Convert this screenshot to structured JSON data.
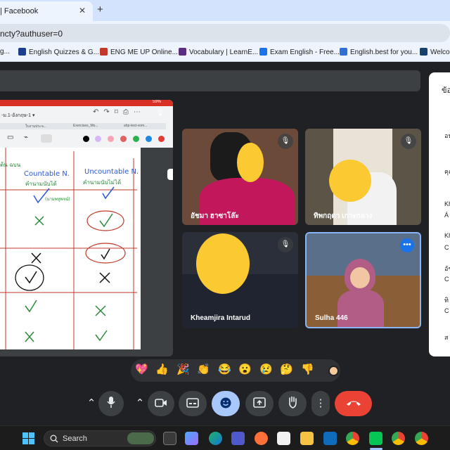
{
  "browser": {
    "tab_title": "| Facebook",
    "tab_close": "✕",
    "new_tab": "+",
    "url": "ncty?authuser=0",
    "bookmarks": [
      {
        "label": "g...",
        "color": "#2f6fd6"
      },
      {
        "label": "English Quizzes & G...",
        "color": "#1a3f8f"
      },
      {
        "label": "ENG ME UP Online...",
        "color": "#c0392b"
      },
      {
        "label": "Vocabulary | LearnE...",
        "color": "#5b2c83"
      },
      {
        "label": "Exam English - Free...",
        "color": "#1a73e8"
      },
      {
        "label": "English.best for you...",
        "color": "#2f6fd6"
      },
      {
        "label": "Welcom",
        "color": "#16406e"
      }
    ]
  },
  "presentation": {
    "tablet_title": "-ม.1-อังกฤษ-1 ▾",
    "tablet_tabs": [
      "ใบงานประจ...",
      "Exercises_Mo...",
      "ahp-test-vom..."
    ],
    "battery": "59%",
    "countable_label": "Countable N.",
    "countable_sub": "คำนามนับได้",
    "uncountable_label": "Uncountable N.",
    "uncountable_sub": "คำนามนับไม่ได้",
    "note": "(นามพหูพจน์)",
    "row_label": "ต้น ฉบน"
  },
  "participants": [
    {
      "name": "อัชมา ฮาซาโล๊ะ",
      "mic": "muted"
    },
    {
      "name": "ทิพกฤตา เกาะกลาง",
      "mic": "muted"
    },
    {
      "name": "Kheamjira Intarud",
      "mic": "muted"
    },
    {
      "name": "Sulha 446",
      "mic": "active"
    }
  ],
  "side_panel": {
    "heading": "ข้อ",
    "items": [
      "อนุ",
      "คุณ",
      "Kh",
      "Á",
      "Kh",
      "C",
      "อัช",
      "C",
      "ทิ",
      "C",
      "ส"
    ]
  },
  "reactions": [
    "💖",
    "👍",
    "🎉",
    "👏",
    "😂",
    "😮",
    "😢",
    "🤔",
    "👎"
  ],
  "controls": {
    "chevron_up": "⌃",
    "more": "⋮",
    "hangup_color": "#ea4335",
    "accent_color": "#a8c7fa"
  },
  "taskbar": {
    "search_label": "Search"
  }
}
